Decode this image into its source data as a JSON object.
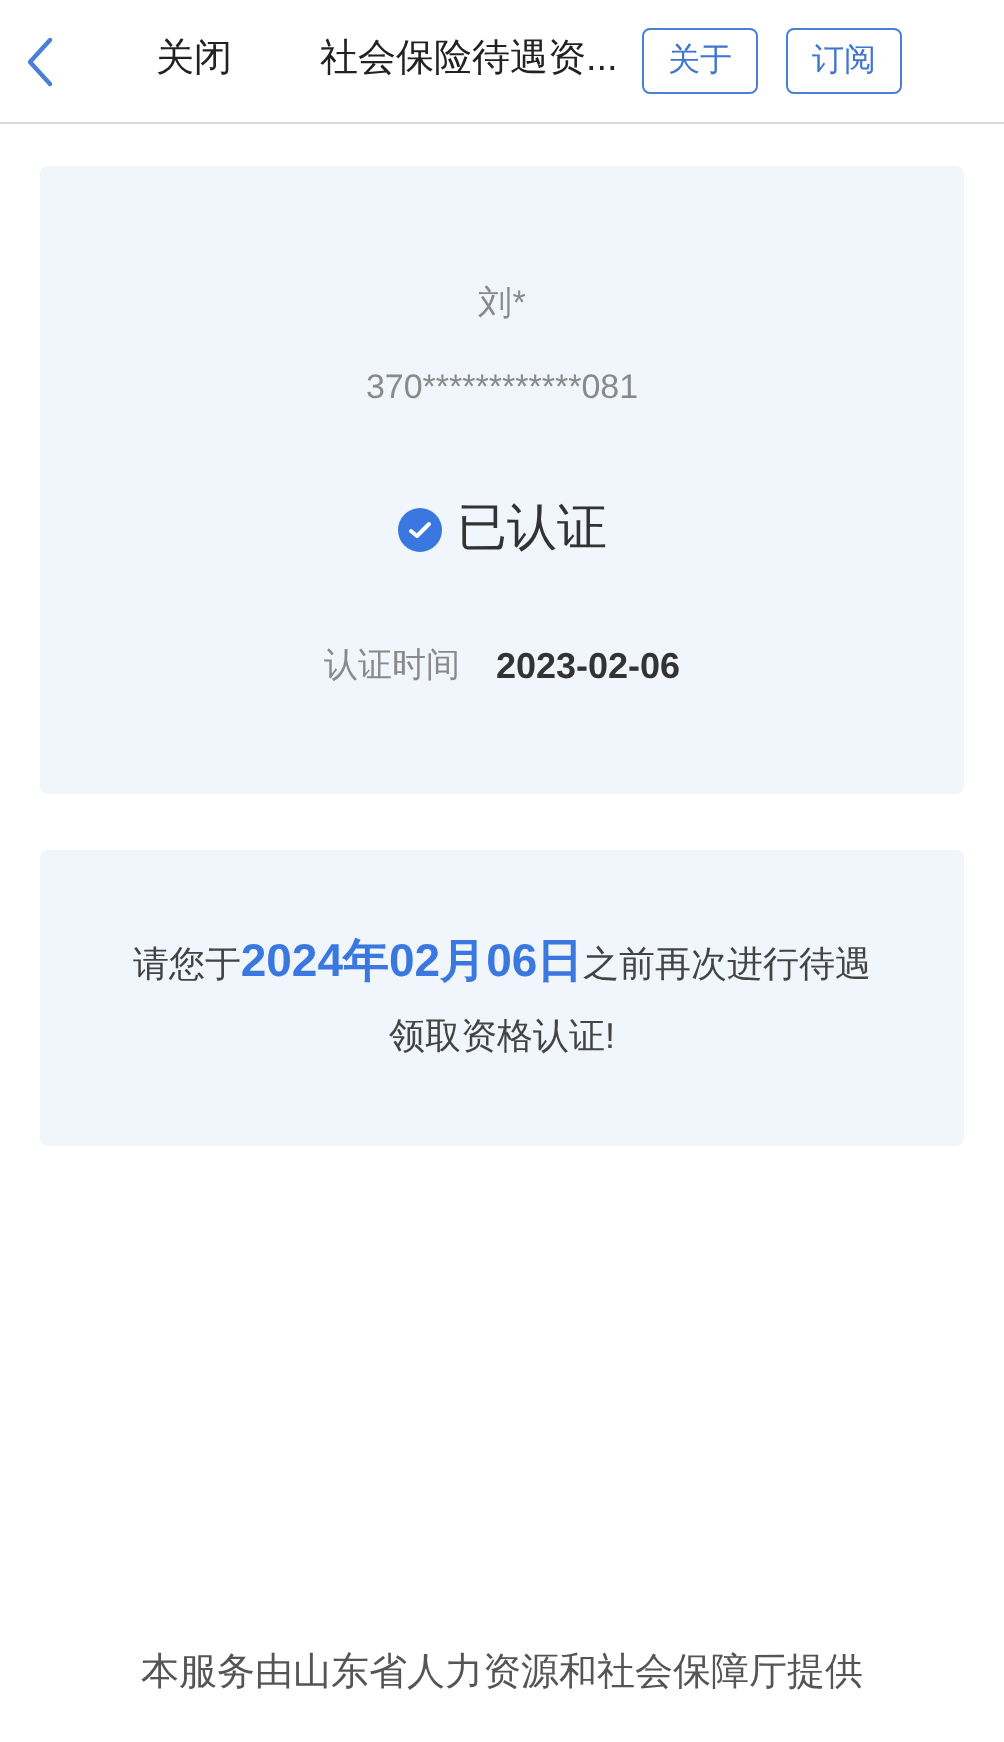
{
  "nav_bar": {
    "close_label": "关闭",
    "title": "社会保险待遇资...",
    "buttons": [
      "关于",
      "订阅"
    ]
  },
  "identity_card": {
    "name": "刘*",
    "id_number": "370************081",
    "status": {
      "verified": true,
      "label": "已认证"
    },
    "time_label": "认证时间",
    "time_value": "2023-02-06"
  },
  "notice_card": {
    "text_before": "请您于",
    "highlight": "2024年02月06日",
    "text_after": "之前再次进行待遇领取资格认证!"
  },
  "footer": "本服务由山东省人力资源和社会保障厅提供"
}
